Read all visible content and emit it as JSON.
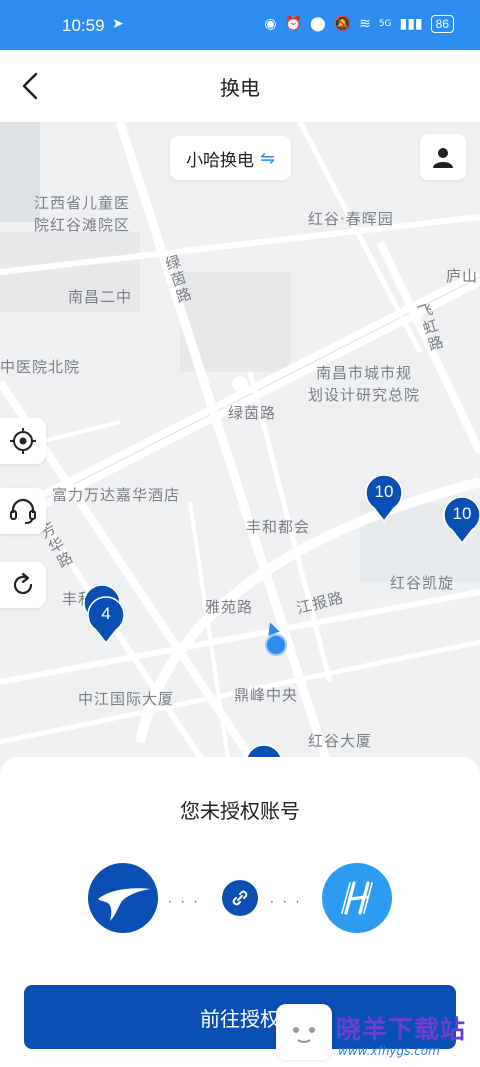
{
  "status_bar": {
    "time": "10:59",
    "battery": "86",
    "network": "5G"
  },
  "header": {
    "title": "换电"
  },
  "map": {
    "brand_pill_label": "小哈换电",
    "labels": [
      "江西省儿童医",
      "院红谷滩院区",
      "红谷·春晖园",
      "庐山",
      "南昌二中",
      "绿茵路",
      "飞虹路",
      "中医院北院",
      "南昌市城市规",
      "划设计研究总院",
      "绿茵路",
      "富力万达嘉华酒店",
      "丰和都会",
      "芳华路",
      "红谷凯旋",
      "丰和园",
      "雅苑路",
      "江报路",
      "中江国际大厦",
      "鼎峰中央",
      "红谷大厦"
    ],
    "markers": [
      "10",
      "10",
      "4"
    ]
  },
  "sheet": {
    "prompt": "您未授权账号",
    "cta_label": "前往授权"
  },
  "watermark": {
    "brand": "晓羊下载站",
    "url": "www.xfhygs.com"
  },
  "colors": {
    "status_bar": "#2d8cf0",
    "primary": "#0a4fb3",
    "accent": "#2d9cf0",
    "map_bg": "#eef0f1"
  }
}
